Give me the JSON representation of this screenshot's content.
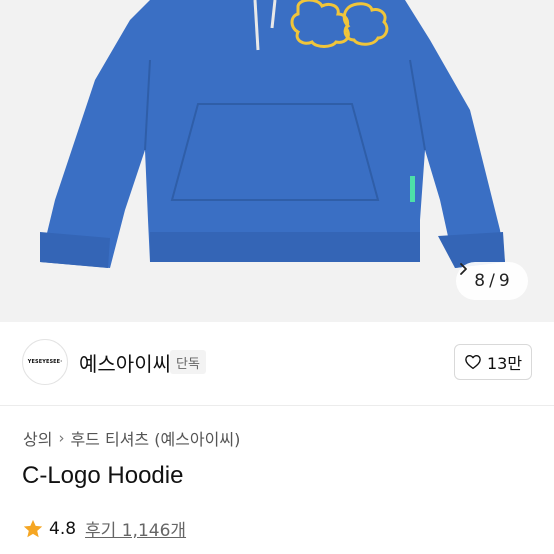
{
  "gallery": {
    "counter_current": "8",
    "counter_sep": "/",
    "counter_total": "9",
    "image_colors": {
      "hoodie": "#3a6fc4",
      "background": "#f2f2f2",
      "logo": "#f0c53a"
    }
  },
  "brand": {
    "logo_text": "YESEYESEE·",
    "name": "예스아이씨",
    "badge": "단독",
    "likes": "13만"
  },
  "breadcrumb": {
    "items": [
      "상의",
      "후드 티셔츠 (예스아이씨)"
    ]
  },
  "product": {
    "title": "C-Logo Hoodie"
  },
  "rating": {
    "score": "4.8",
    "reviews_label": "후기 1,146개",
    "star_color": "#f5a623"
  }
}
